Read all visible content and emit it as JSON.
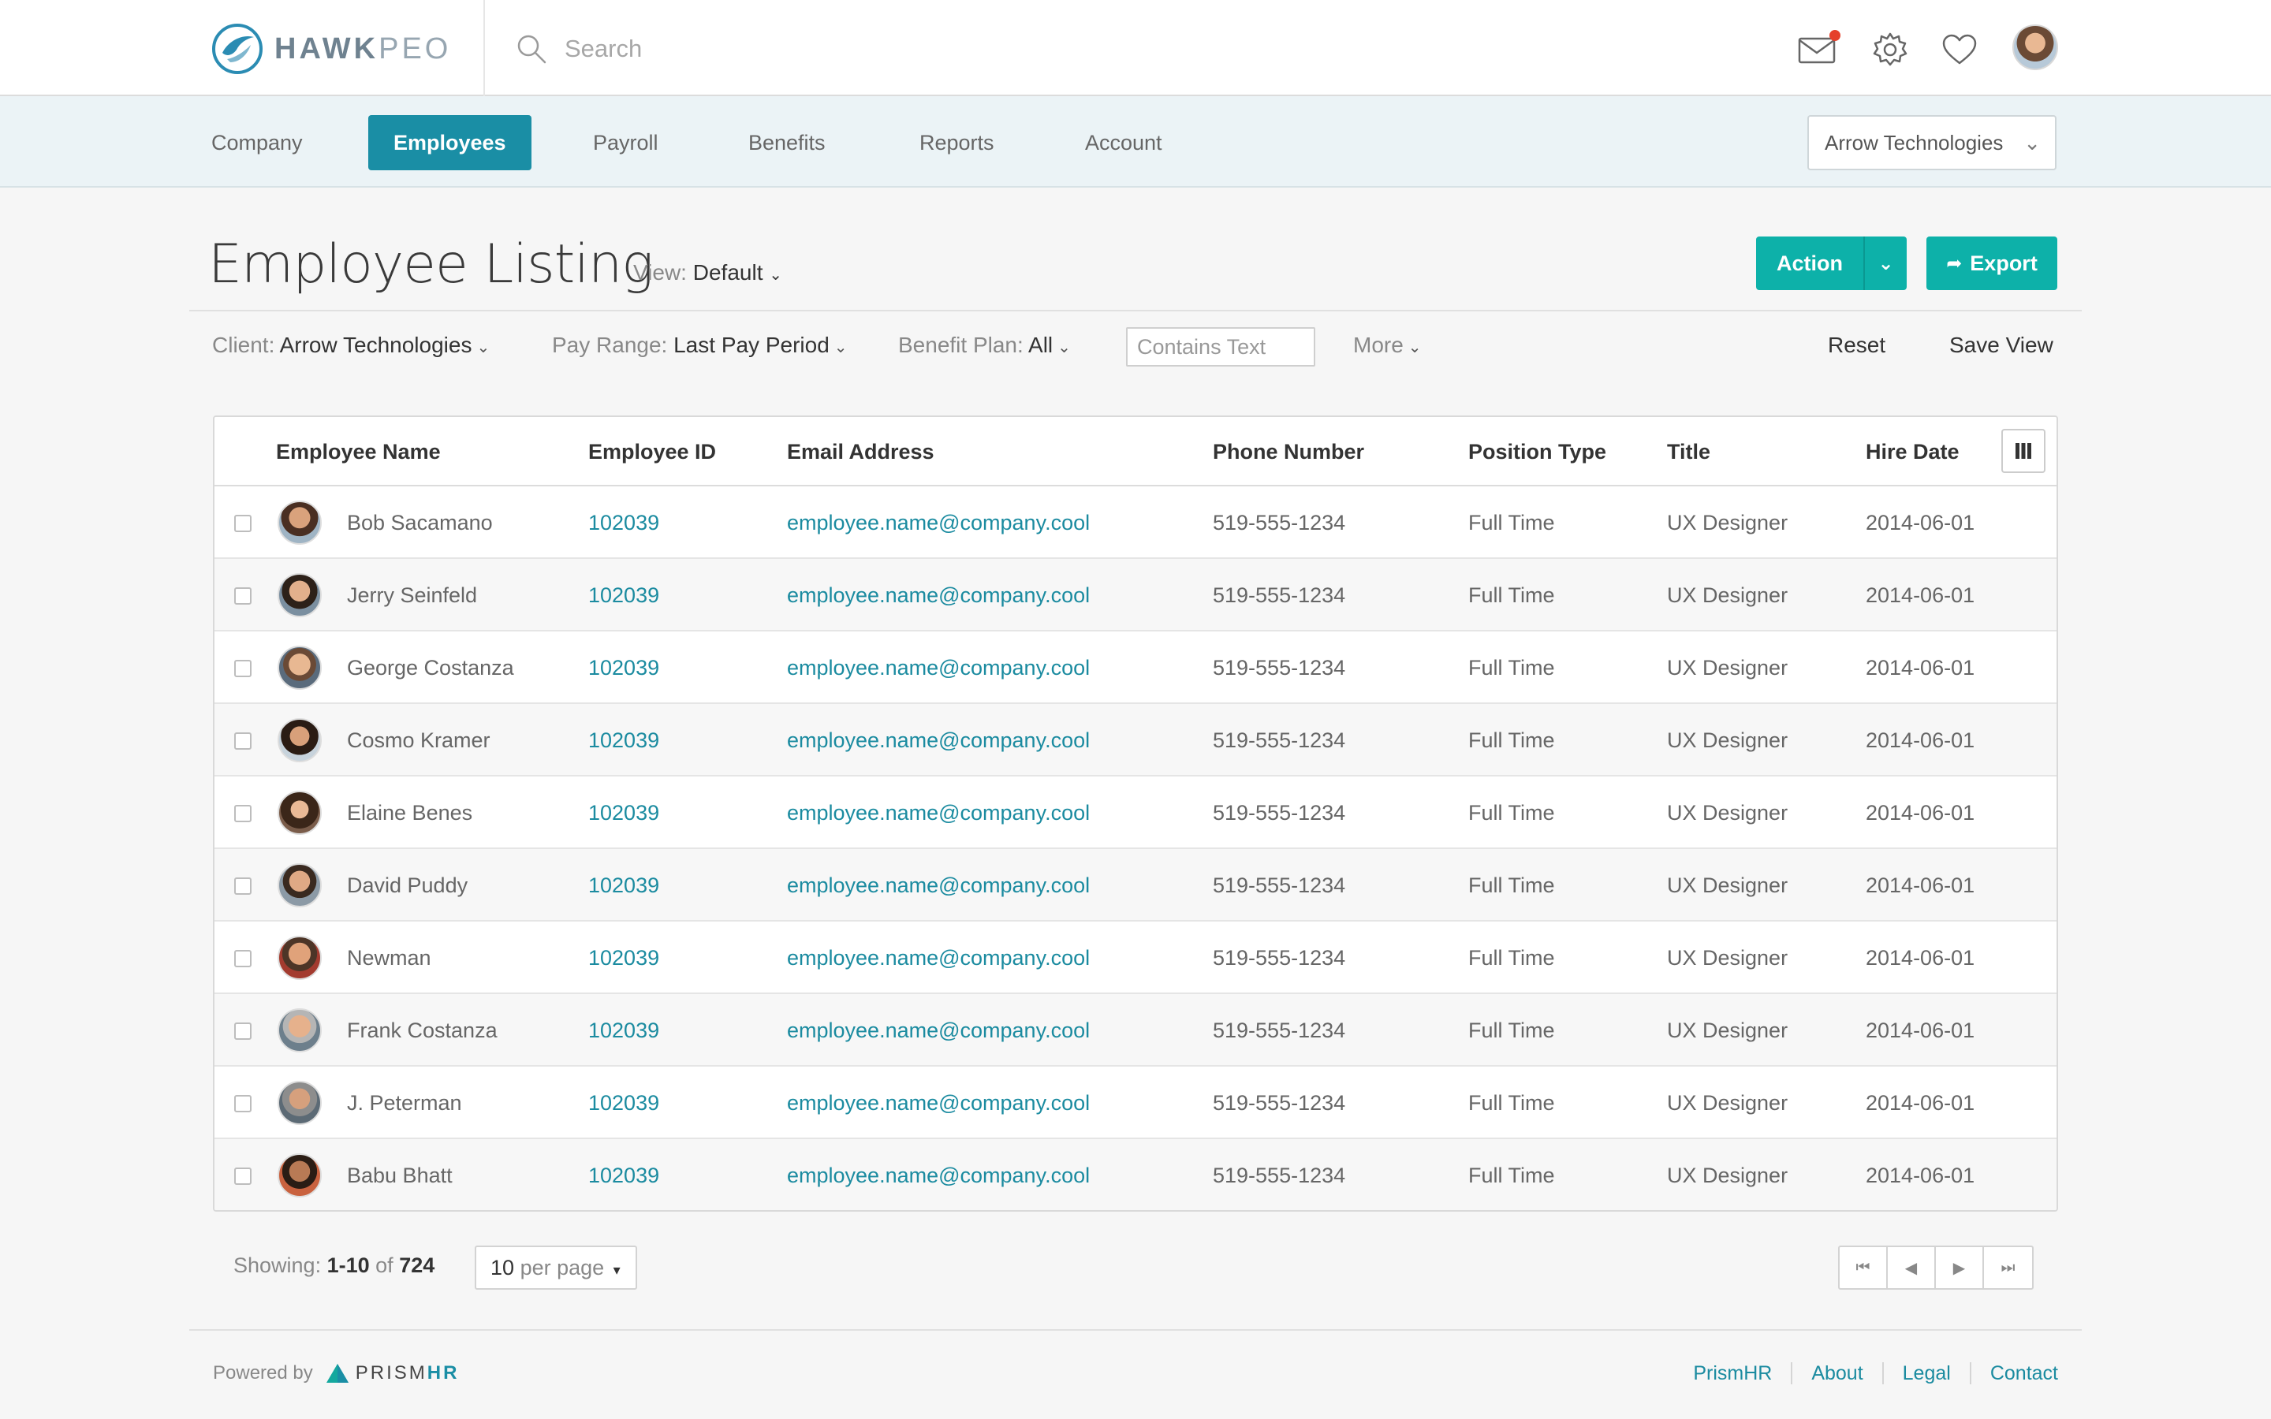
{
  "brand": {
    "logo_bold": "HAWK",
    "logo_light": "PEO"
  },
  "search": {
    "placeholder": "Search"
  },
  "header_icons": [
    "mail-icon",
    "gear-icon",
    "heart-icon"
  ],
  "nav": {
    "items": [
      {
        "label": "Company",
        "active": false
      },
      {
        "label": "Employees",
        "active": true
      },
      {
        "label": "Payroll",
        "active": false
      },
      {
        "label": "Benefits",
        "active": false
      },
      {
        "label": "Reports",
        "active": false
      },
      {
        "label": "Account",
        "active": false
      }
    ],
    "client_select": "Arrow Technologies"
  },
  "page": {
    "title": "Employee Listing",
    "view_label": "View:",
    "view_value": "Default",
    "action_label": "Action",
    "export_label": "Export"
  },
  "filters": {
    "client_label": "Client:",
    "client_value": "Arrow Technologies",
    "pay_range_label": "Pay Range:",
    "pay_range_value": "Last Pay Period",
    "benefit_plan_label": "Benefit Plan:",
    "benefit_plan_value": "All",
    "contains_placeholder": "Contains Text",
    "more_label": "More",
    "reset_label": "Reset",
    "save_view_label": "Save View"
  },
  "table": {
    "columns": [
      "Employee Name",
      "Employee ID",
      "Email Address",
      "Phone Number",
      "Position Type",
      "Title",
      "Hire Date"
    ],
    "rows": [
      {
        "name": "Bob Sacamano",
        "id": "102039",
        "email": "employee.name@company.cool",
        "phone": "519-555-1234",
        "position": "Full Time",
        "title": "UX Designer",
        "hire_date": "2014-06-01"
      },
      {
        "name": "Jerry Seinfeld",
        "id": "102039",
        "email": "employee.name@company.cool",
        "phone": "519-555-1234",
        "position": "Full Time",
        "title": "UX Designer",
        "hire_date": "2014-06-01"
      },
      {
        "name": "George Costanza",
        "id": "102039",
        "email": "employee.name@company.cool",
        "phone": "519-555-1234",
        "position": "Full Time",
        "title": "UX Designer",
        "hire_date": "2014-06-01"
      },
      {
        "name": "Cosmo Kramer",
        "id": "102039",
        "email": "employee.name@company.cool",
        "phone": "519-555-1234",
        "position": "Full Time",
        "title": "UX Designer",
        "hire_date": "2014-06-01"
      },
      {
        "name": "Elaine Benes",
        "id": "102039",
        "email": "employee.name@company.cool",
        "phone": "519-555-1234",
        "position": "Full Time",
        "title": "UX Designer",
        "hire_date": "2014-06-01"
      },
      {
        "name": "David Puddy",
        "id": "102039",
        "email": "employee.name@company.cool",
        "phone": "519-555-1234",
        "position": "Full Time",
        "title": "UX Designer",
        "hire_date": "2014-06-01"
      },
      {
        "name": "Newman",
        "id": "102039",
        "email": "employee.name@company.cool",
        "phone": "519-555-1234",
        "position": "Full Time",
        "title": "UX Designer",
        "hire_date": "2014-06-01"
      },
      {
        "name": "Frank Costanza",
        "id": "102039",
        "email": "employee.name@company.cool",
        "phone": "519-555-1234",
        "position": "Full Time",
        "title": "UX Designer",
        "hire_date": "2014-06-01"
      },
      {
        "name": "J. Peterman",
        "id": "102039",
        "email": "employee.name@company.cool",
        "phone": "519-555-1234",
        "position": "Full Time",
        "title": "UX Designer",
        "hire_date": "2014-06-01"
      },
      {
        "name": "Babu Bhatt",
        "id": "102039",
        "email": "employee.name@company.cool",
        "phone": "519-555-1234",
        "position": "Full Time",
        "title": "UX Designer",
        "hire_date": "2014-06-01"
      }
    ]
  },
  "pagination": {
    "showing_label": "Showing:",
    "range": "1-10",
    "of_label": "of",
    "total": "724",
    "per_page_value": "10",
    "per_page_label": "per page"
  },
  "footer": {
    "powered_by": "Powered by",
    "prism_light": "PRISM",
    "prism_bold": "HR",
    "links": [
      "PrismHR",
      "About",
      "Legal",
      "Contact"
    ]
  },
  "colors": {
    "accent": "#0db1a9",
    "nav_active": "#1a8ea5",
    "link": "#1b8ba0",
    "notification": "#e5402b"
  }
}
